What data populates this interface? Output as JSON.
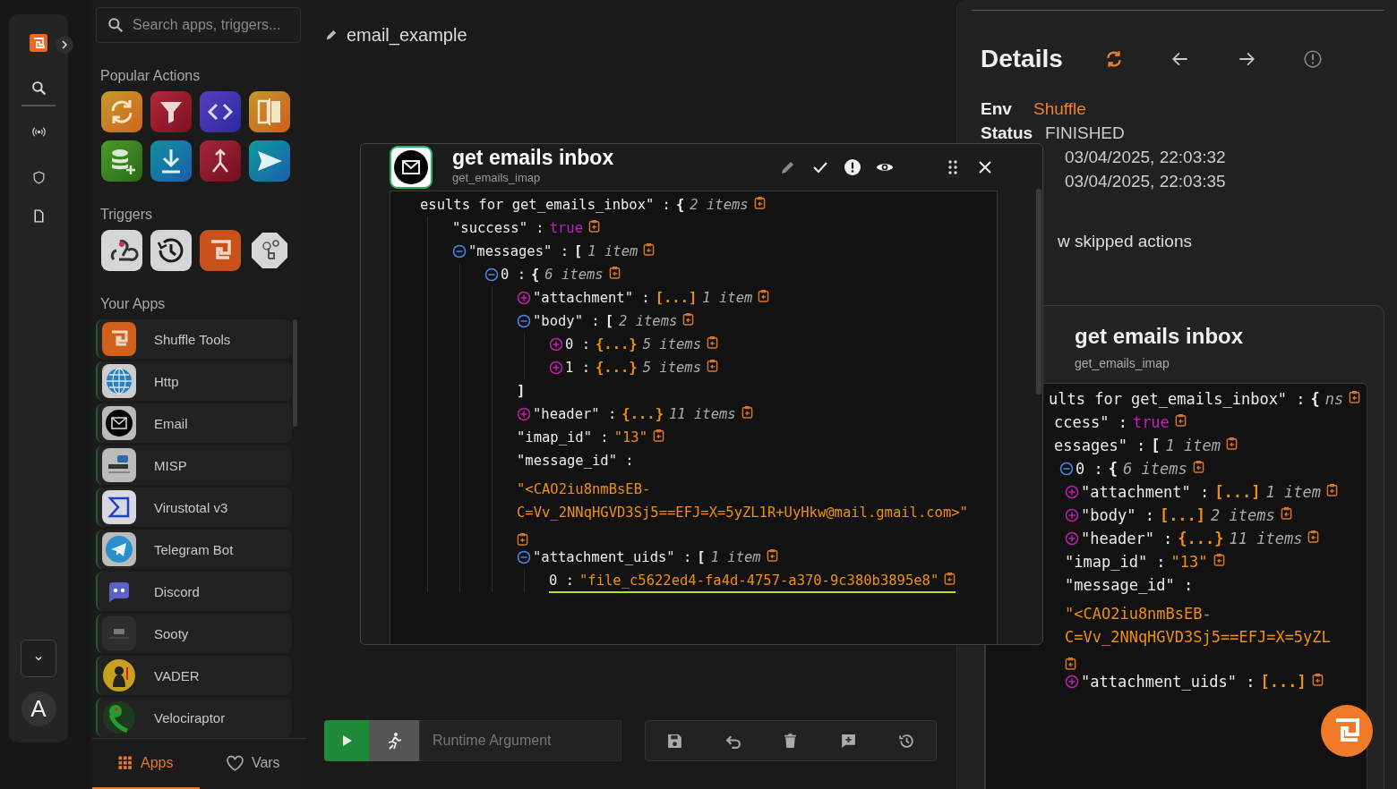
{
  "rail": {
    "avatar": "A"
  },
  "sidebar": {
    "search": {
      "placeholder": "Search apps, triggers..."
    },
    "popular_title": "Popular Actions",
    "triggers_title": "Triggers",
    "apps_title": "Your Apps",
    "apps": [
      {
        "name": "Shuffle Tools"
      },
      {
        "name": "Http"
      },
      {
        "name": "Email"
      },
      {
        "name": "MISP"
      },
      {
        "name": "Virustotal v3"
      },
      {
        "name": "Telegram Bot"
      },
      {
        "name": "Discord"
      },
      {
        "name": "Sooty"
      },
      {
        "name": "VADER"
      },
      {
        "name": "Velociraptor"
      }
    ],
    "tabs": [
      {
        "label": "Apps",
        "selected": true
      },
      {
        "label": "Vars",
        "selected": false
      }
    ]
  },
  "canvas": {
    "title": "email_example",
    "runtime_argument": {
      "placeholder": "Runtime Argument"
    }
  },
  "result_popup": {
    "title": "get emails inbox",
    "subtitle": "get_emails_imap",
    "tree": [
      {
        "key": "esults for get_emails_inbox\" :",
        "bracket": "{",
        "count": "2 items",
        "children": [
          {
            "key": "\"success\" :",
            "value": "true",
            "kind": "bool"
          },
          {
            "key": "\"messages\" :",
            "expanded": true,
            "bracket": "[",
            "count": "1 item",
            "children": [
              {
                "index": "0 :",
                "expanded": true,
                "bracket": "{",
                "count": "6 items",
                "children": [
                  {
                    "key": "\"attachment\" :",
                    "expanded": false,
                    "bracket": "[...]",
                    "count": "1 item"
                  },
                  {
                    "key": "\"body\" :",
                    "expanded": true,
                    "bracket": "[",
                    "count": "2 items",
                    "close": "]",
                    "children": [
                      {
                        "index": "0 :",
                        "expanded": false,
                        "bracket": "{...}",
                        "count": "5 items"
                      },
                      {
                        "index": "1 :",
                        "expanded": false,
                        "bracket": "{...}",
                        "count": "5 items"
                      }
                    ]
                  },
                  {
                    "key": "\"header\" :",
                    "expanded": false,
                    "bracket": "{...}",
                    "count": "11 items"
                  },
                  {
                    "key": "\"imap_id\" :",
                    "value": "\"13\"",
                    "kind": "string"
                  },
                  {
                    "key": "\"message_id\" :",
                    "value": "\"<CAO2iu8nmBsEB-C=Vv_2NNqHGVD3Sj5==EFJ=X=5yZL1R+UyHkw@mail.gmail.com>\"",
                    "kind": "string"
                  },
                  {
                    "key": "\"attachment_uids\" :",
                    "expanded": true,
                    "bracket": "[",
                    "count": "1 item",
                    "children": [
                      {
                        "index": "0 :",
                        "value": "\"file_c5622ed4-fa4d-4757-a370-9c380b3895e8\"",
                        "kind": "string",
                        "highlighted": true
                      }
                    ]
                  }
                ]
              }
            ]
          }
        ]
      }
    ]
  },
  "details": {
    "title": "Details",
    "env_label": "Env",
    "env_value": "Shuffle",
    "status_label": "Status",
    "status_value": "FINISHED",
    "times": [
      "03/04/2025, 22:03:32",
      "03/04/2025, 22:03:35"
    ],
    "skipped": "w skipped actions",
    "card": {
      "title": "get emails inbox",
      "subtitle": "get_emails_imap",
      "tree": [
        {
          "key": "ults for get_emails_inbox\" :",
          "bracket": "{",
          "count": "ns",
          "children": [
            {
              "key": "ccess\" :",
              "value": "true",
              "kind": "bool"
            },
            {
              "key": "essages\" :",
              "bracket": "[",
              "count": "1 item",
              "children": [
                {
                  "index": "0 :",
                  "expanded": true,
                  "bracket": "{",
                  "count": "6 items",
                  "children": [
                    {
                      "key": "\"attachment\" :",
                      "expanded": false,
                      "bracket": "[...]",
                      "count": "1 item"
                    },
                    {
                      "key": "\"body\" :",
                      "expanded": false,
                      "bracket": "[...]",
                      "count": "2 items"
                    },
                    {
                      "key": "\"header\" :",
                      "expanded": false,
                      "bracket": "{...}",
                      "count": "11 items"
                    },
                    {
                      "key": "\"imap_id\" :",
                      "value": "\"13\"",
                      "kind": "string"
                    },
                    {
                      "key": "\"message_id\" :",
                      "value": "\"<CAO2iu8nmBsEB-C=Vv_2NNqHGVD3Sj5==EFJ=X=5yZL",
                      "kind": "string"
                    },
                    {
                      "key": "\"attachment_uids\" :",
                      "expanded": false,
                      "bracket": "[...]"
                    }
                  ]
                }
              ]
            }
          ]
        }
      ]
    }
  }
}
